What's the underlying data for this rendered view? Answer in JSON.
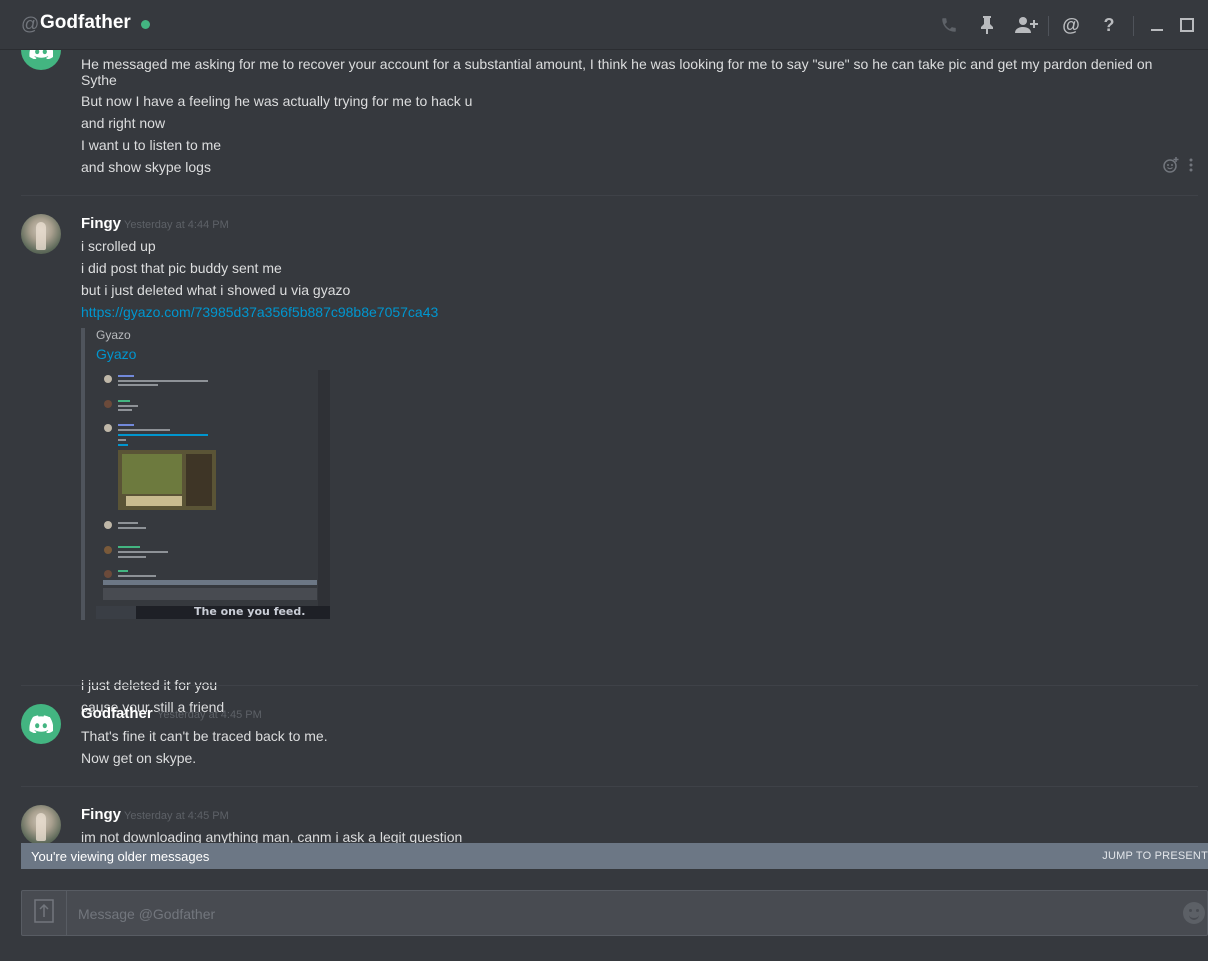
{
  "header": {
    "at_symbol": "@",
    "title": "Godfather",
    "icons": [
      "phone-icon",
      "pin-icon",
      "add-friend-icon",
      "mention-icon",
      "help-icon",
      "minimize-icon",
      "maximize-icon"
    ],
    "mention_glyph": "@",
    "help_glyph": "?"
  },
  "messages": [
    {
      "author": "",
      "lines": [
        "He messaged me asking for me to recover your account for a substantial amount, I think he was looking for me to say \"sure\" so he can take pic and get my pardon denied on Sythe",
        "But now I have a feeling he was actually trying for me to hack u",
        "and right now",
        "I want u to listen to me",
        "and show skype logs"
      ]
    },
    {
      "author": "Fingy",
      "timestamp": "Yesterday at 4:44 PM",
      "lines": [
        "i scrolled up",
        "i did post that pic buddy sent me",
        "but i just deleted what i showed u via gyazo"
      ],
      "link": "https://gyazo.com/73985d37a356f5b887c98b8e7057ca43",
      "embed": {
        "provider": "Gyazo",
        "title": "Gyazo",
        "caption": "The one you feed."
      },
      "after_lines": [
        "i just deleted it for you",
        "cause your still a friend"
      ]
    },
    {
      "author": "Godfather",
      "timestamp": "Yesterday at 4:45 PM",
      "lines": [
        "That's fine it can't be traced back to me.",
        "Now get on skype."
      ]
    },
    {
      "author": "Fingy",
      "timestamp": "Yesterday at 4:45 PM",
      "lines": [
        "im not downloading anything man, canm i ask a legit question"
      ]
    }
  ],
  "older_bar": {
    "text": "You're viewing older messages",
    "jump": "JUMP TO PRESENT"
  },
  "composer": {
    "placeholder": "Message @Godfather"
  },
  "colors": {
    "background": "#36393e",
    "accent": "#43b581",
    "link": "#0096cf",
    "older_bar": "#6c7785"
  }
}
